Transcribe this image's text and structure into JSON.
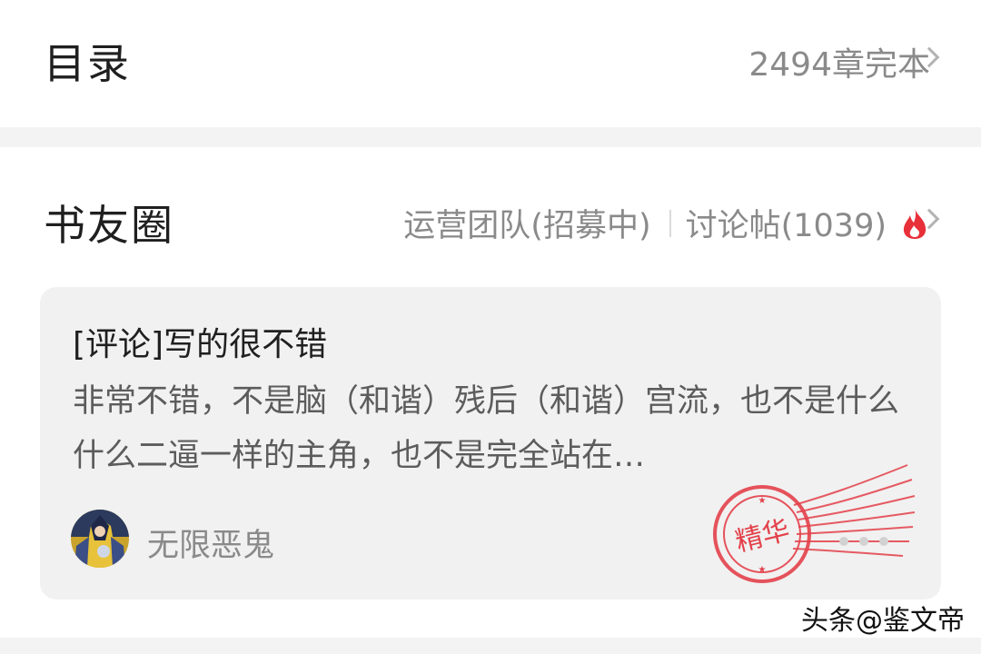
{
  "toc": {
    "title": "目录",
    "status": "2494章完本"
  },
  "circle": {
    "title": "书友圈",
    "ops_link": "运营团队(招募中)",
    "discussion_link": "讨论帖(1039)",
    "featured_post": {
      "title": "[评论]写的很不错",
      "body": "非常不错，不是脑（和谐）残后（和谐）宫流，也不是什么什么二逼一样的主角，也不是完全站在…",
      "author": "无限恶鬼",
      "badge": "精华"
    }
  },
  "watermark": {
    "source": "头条",
    "account": "@鉴文帝"
  },
  "colors": {
    "flame": "#e8303a",
    "stamp": "#e3404a",
    "text_primary": "#1f1f1f",
    "text_secondary": "#8a8a8a"
  }
}
